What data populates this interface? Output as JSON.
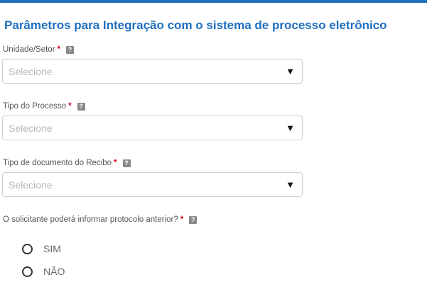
{
  "section": {
    "title": "Parâmetros para Integração com o sistema de processo eletrônico"
  },
  "fields": [
    {
      "label": "Unidade/Setor",
      "required": "*",
      "help": "?",
      "placeholder": "Selecione",
      "arrow": "▼"
    },
    {
      "label": "Tipo do Processo",
      "required": "*",
      "help": "?",
      "placeholder": "Selecione",
      "arrow": "▼"
    },
    {
      "label": "Tipo de documento do Recibo",
      "required": "*",
      "help": "?",
      "placeholder": "Selecione",
      "arrow": "▼"
    }
  ],
  "question": {
    "label": "O solicitante poderá informar protocolo anterior?",
    "required": "*",
    "help": "?",
    "options": [
      {
        "label": "SIM",
        "selected": false
      },
      {
        "label": "NÃO",
        "selected": false
      }
    ]
  },
  "colors": {
    "accent": "#1f6fbf",
    "required": "#d0021b"
  }
}
